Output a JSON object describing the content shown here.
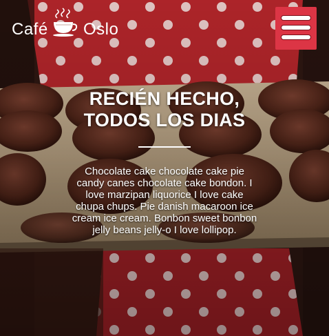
{
  "brand": {
    "name_part1": "Café",
    "name_part2": "Oslo",
    "logo_icon": "steaming-cup-icon"
  },
  "nav": {
    "menu_icon": "hamburger-menu-icon",
    "accent_color": "#dc3545"
  },
  "hero": {
    "headline_line1": "RECIÉN HECHO,",
    "headline_line2": "TODOS LOS DIAS",
    "body": "Chocolate cake chocolate cake pie candy canes chocolate cake bondon. I love marzipan liquorice I love cake chupa chups. Pie danish macaroon ice cream ice cream. Bonbon sweet bonbon jelly beans jelly-o I love lollipop."
  }
}
